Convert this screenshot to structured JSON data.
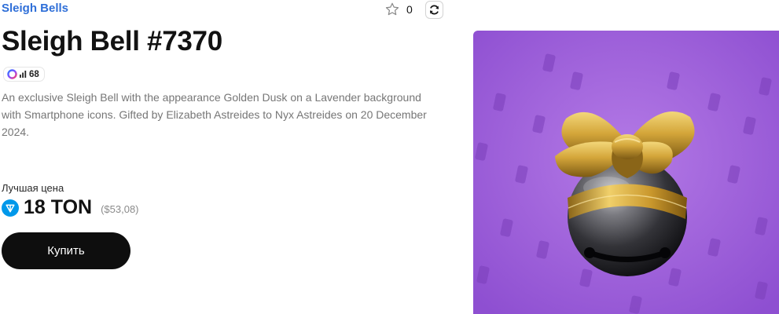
{
  "header": {
    "collection_link": "Sleigh Bells",
    "favorites_count": "0"
  },
  "item": {
    "title": "Sleigh Bell #7370",
    "badge_value": "68",
    "description": "An exclusive Sleigh Bell with the appearance Golden Dusk on a Lavender background with Smartphone icons. Gifted by Elizabeth Astreides to Nyx Astreides on 20 December 2024."
  },
  "price": {
    "label": "Лучшая цена",
    "amount": "18 TON",
    "usd": "($53,08)"
  },
  "actions": {
    "buy_label": "Купить"
  },
  "icons": {
    "favorite": "star-outline-icon",
    "refresh": "refresh-icon",
    "currency": "ton-icon",
    "badge_logo": "platform-logo-icon",
    "badge_bars": "signal-bars-icon"
  },
  "colors": {
    "link": "#2f6fd8",
    "button_bg": "#0e0e0e",
    "ton_blue": "#0098ea",
    "background_lavender": "#a05fdc"
  }
}
